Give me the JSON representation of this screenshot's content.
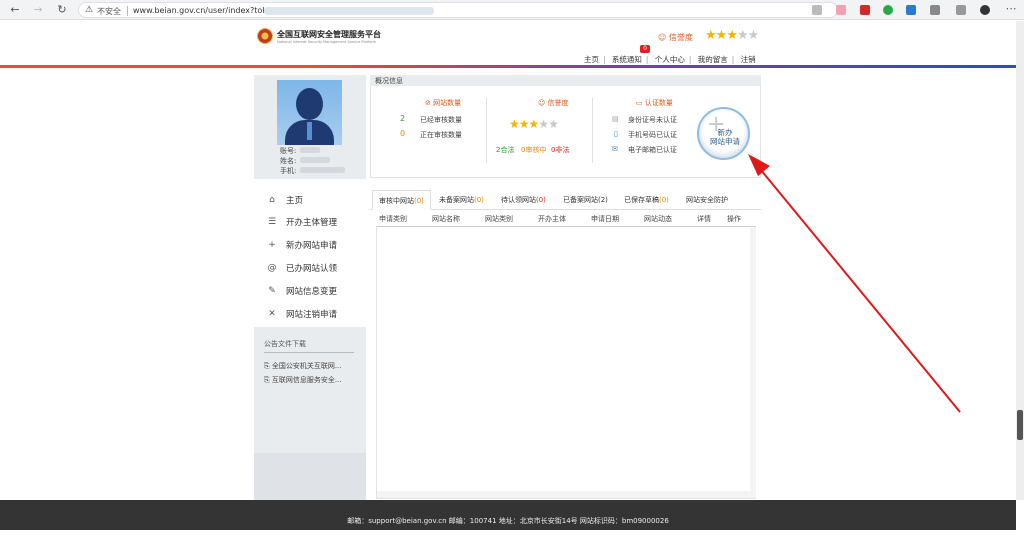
{
  "browser": {
    "warning": "不安全",
    "url": "www.beian.gov.cn/user/index?token="
  },
  "header": {
    "site_title": "全国互联网安全管理服务平台",
    "site_subtitle": "National Internet Security Management Service Platform",
    "credit_label": "信誉度",
    "credit_stars": 3,
    "credit_max": 5,
    "nav": [
      "主页",
      "系统通知",
      "个人中心",
      "我的留言",
      "注销"
    ],
    "notice_count": "0"
  },
  "profile": {
    "account_label": "账号:",
    "name_label": "姓名:",
    "phone_label": "手机:"
  },
  "sidebar": {
    "items": [
      {
        "icon": "home-icon",
        "label": "主页"
      },
      {
        "icon": "list-icon",
        "label": "开办主体管理"
      },
      {
        "icon": "plus-icon",
        "label": "新办网站申请"
      },
      {
        "icon": "at-icon",
        "label": "已办网站认领"
      },
      {
        "icon": "edit-icon",
        "label": "网站信息变更"
      },
      {
        "icon": "close-icon",
        "label": "网站注销申请"
      }
    ],
    "downloads_title": "公告文件下载",
    "downloads": [
      "全国公安机关互联网...",
      "互联网信息服务安全..."
    ]
  },
  "overview": {
    "title": "概况信息",
    "site_count": {
      "heading": "网站数量",
      "approved_num": "2",
      "approved_label": "已经审核数量",
      "pending_num": "0",
      "pending_label": "正在审核数量"
    },
    "credit": {
      "heading": "信誉度",
      "stars": 3,
      "max": 5,
      "legal": "2合法",
      "reviewing": "0审核中",
      "illegal": "0非法"
    },
    "certification": {
      "heading": "认证数量",
      "id_card": "身份证号未认证",
      "phone": "手机号码已认证",
      "email": "电子邮箱已认证"
    },
    "new_button": "新办\n网站申请"
  },
  "tabs": [
    {
      "label": "审核中网站",
      "count": "(0)"
    },
    {
      "label": "未备案网站",
      "count": "(0)"
    },
    {
      "label": "待认领网站",
      "count": "(0)"
    },
    {
      "label": "已备案网站",
      "count": "(2)"
    },
    {
      "label": "已保存草稿",
      "count": "(0)"
    },
    {
      "label": "网站安全防护",
      "count": ""
    }
  ],
  "table": {
    "columns": [
      "申请类别",
      "网站名称",
      "网站类别",
      "开办主体",
      "申请日期",
      "网站动态",
      "详情",
      "操作"
    ]
  },
  "footer": {
    "text": "邮箱：support@beian.gov.cn    邮编：100741    地址：北京市长安街14号    网站标识码：bm09000026"
  },
  "colors": {
    "accent_orange": "#e05a1a",
    "star": "#f5b400",
    "annotation_arrow": "#e01818"
  }
}
